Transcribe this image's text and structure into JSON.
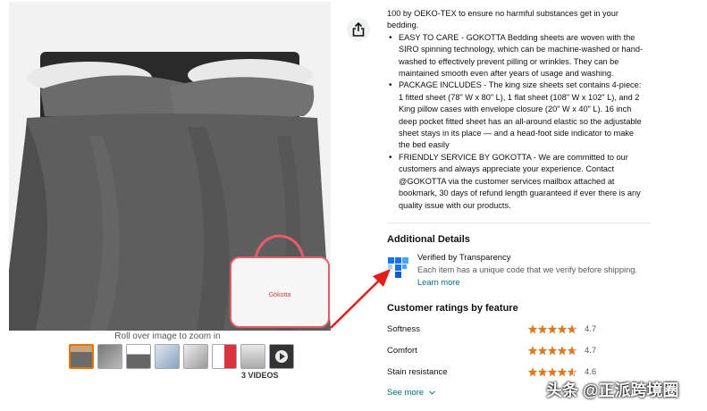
{
  "image_gallery": {
    "zoom_hint": "Roll over image to zoom in",
    "videos_label": "3 VIDEOS",
    "bag_brand": "Gökotta"
  },
  "bullets": [
    {
      "text": "100 by OEKO-TEX to ensure no harmful substances get in your",
      "continuation": true
    },
    {
      "text": "bedding.",
      "continuation": true
    },
    {
      "text": "EASY TO CARE - GOKOTTA Bedding sheets are woven with the",
      "continuation": false
    },
    {
      "text": "SIRO spinning technology, which can be machine-washed or hand-",
      "continuation": true
    },
    {
      "text": "washed to effectively prevent pilling or wrinkles. They can be",
      "continuation": true
    },
    {
      "text": "maintained smooth even after years of usage and washing.",
      "continuation": true
    },
    {
      "text": "PACKAGE INCLUDES - The king size sheets set contains 4-piece:",
      "continuation": false
    },
    {
      "text": "1 fitted sheet (78\" W x 80\" L), 1 flat sheet (108\" W x 102\" L), and 2",
      "continuation": true
    },
    {
      "text": "King pillow cases with envelope closure (20\" W x 40\" L). 16 inch",
      "continuation": true
    },
    {
      "text": "deep pocket fitted sheet has an all-around elastic so the adjustable",
      "continuation": true
    },
    {
      "text": "sheet stays in its place — and a head-foot side indicator to make",
      "continuation": true
    },
    {
      "text": "the bed easily",
      "continuation": true
    },
    {
      "text": "FRIENDLY SERVICE BY GOKOTTA - We are committed to our",
      "continuation": false
    },
    {
      "text": "customers and always appreciate your experience. Contact",
      "continuation": true
    },
    {
      "text": "@GOKOTTA via the customer services mailbox attached at",
      "continuation": true
    },
    {
      "text": "bookmark, 30 days of refund length guaranteed if ever there is any",
      "continuation": true
    },
    {
      "text": "quality issue with our products.",
      "continuation": true
    }
  ],
  "additional_details": {
    "title": "Additional Details",
    "verified": "Verified by Transparency",
    "description": "Each item has a unique code that we verify before shipping.",
    "learn_more": "Learn more"
  },
  "ratings": {
    "title": "Customer ratings by feature",
    "items": [
      {
        "name": "Softness",
        "value": "4.7",
        "stars": 4.7
      },
      {
        "name": "Comfort",
        "value": "4.7",
        "stars": 4.7
      },
      {
        "name": "Stain resistance",
        "value": "4.6",
        "stars": 4.6
      }
    ],
    "see_more": "See more"
  },
  "watermark": "头条 @正派跨境圈",
  "colors": {
    "link": "#007185",
    "star": "#de7921",
    "annotation": "#e31b1b",
    "selected_thumb": "#e77600"
  },
  "icons": [
    "share-icon",
    "transparency-logo-icon",
    "play-icon",
    "chevron-down-icon",
    "star-icon"
  ]
}
